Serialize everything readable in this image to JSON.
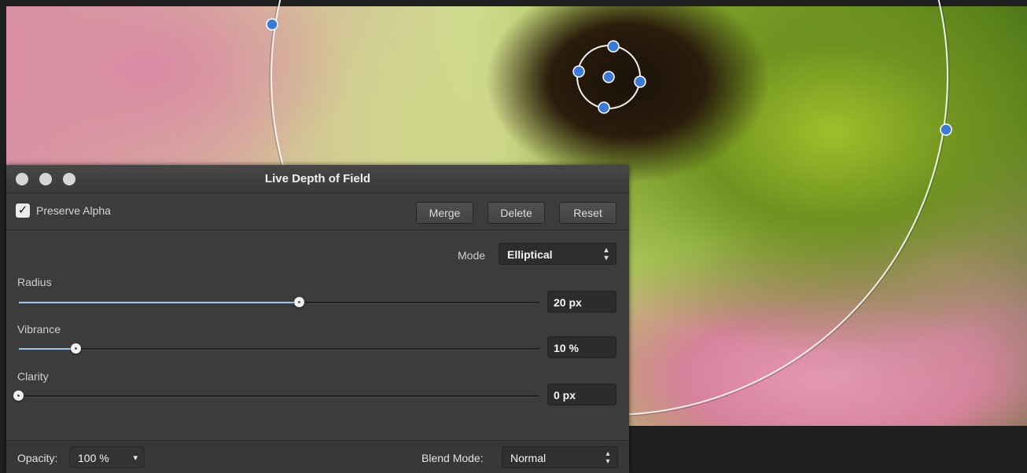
{
  "panel": {
    "title": "Live Depth of Field",
    "preserve_alpha": {
      "label": "Preserve Alpha",
      "checked": true,
      "check_glyph": "✓"
    },
    "buttons": {
      "merge": "Merge",
      "delete": "Delete",
      "reset": "Reset"
    },
    "mode": {
      "label": "Mode",
      "value": "Elliptical"
    },
    "sliders": [
      {
        "label": "Radius",
        "value": "20 px",
        "fraction": 0.54
      },
      {
        "label": "Vibrance",
        "value": "10 %",
        "fraction": 0.11
      },
      {
        "label": "Clarity",
        "value": "0 px",
        "fraction": 0.0
      }
    ],
    "opacity": {
      "label": "Opacity:",
      "value": "100 %",
      "arrow": "▾"
    },
    "blend_mode": {
      "label": "Blend Mode:",
      "value": "Normal"
    },
    "updown_glyph": "▴▾"
  },
  "colors": {
    "accent": "#9dc4f5",
    "handle": "#3b7ad9",
    "panel_bg": "#3c3c3c"
  },
  "icons": {
    "window_controls": [
      "close-button-icon",
      "minimize-button-icon",
      "zoom-button-icon"
    ]
  }
}
